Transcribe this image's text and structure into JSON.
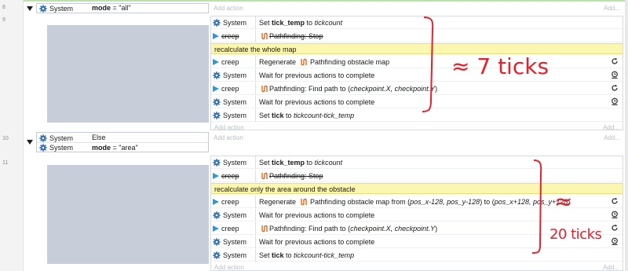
{
  "events": [
    {
      "line": "8",
      "conditions": [
        {
          "object": "System",
          "text_bold": "mode",
          "text_rest": " = \"all\""
        }
      ],
      "add_action": "Add action",
      "add_label": "Add..."
    },
    {
      "line": "9",
      "actions": [
        {
          "object": "System",
          "pre": "Set ",
          "bold": "tick_temp",
          "mid": " to ",
          "italic": "tickcount",
          "post": ""
        },
        {
          "object": "creep",
          "strike": true,
          "text": "Pathfinding: Stop"
        },
        {
          "comment": "recalculate the whole map"
        },
        {
          "object": "creep",
          "pre": "Regenerate ",
          "mid": " Pathfinding obstacle map",
          "right_icon": "refresh-icon"
        },
        {
          "object": "System",
          "text": "Wait for previous actions to complete",
          "right_icon": "clock-icon"
        },
        {
          "object": "creep",
          "pre": "Pathfinding: Find path to (",
          "italic": "checkpoint.X, checkpoint.Y",
          "post": ")",
          "right_icon": "refresh-icon"
        },
        {
          "object": "System",
          "text": "Wait for previous actions to complete",
          "right_icon": "clock-icon"
        },
        {
          "object": "System",
          "pre": "Set ",
          "bold": "tick",
          "mid": " to ",
          "italic": "tickcount-tick_temp",
          "post": ""
        }
      ],
      "add_action": "Add action",
      "add_label": "Add..."
    },
    {
      "line": "10",
      "conditions": [
        {
          "object": "System",
          "text_bold": "",
          "text_rest": "Else"
        },
        {
          "object": "System",
          "text_bold": "mode",
          "text_rest": " = \"area\""
        }
      ],
      "add_action": "Add action",
      "add_label": "Add..."
    },
    {
      "line": "11",
      "actions": [
        {
          "object": "System",
          "pre": "Set ",
          "bold": "tick_temp",
          "mid": " to ",
          "italic": "tickcount",
          "post": ""
        },
        {
          "object": "creep",
          "strike": true,
          "text": "Pathfinding: Stop"
        },
        {
          "comment": "recalculate only the area around the obstacle"
        },
        {
          "object": "creep",
          "pre": "Regenerate ",
          "mid": " Pathfinding obstacle map from (",
          "italic": "pos_x-128, pos_y-128",
          "mid2": ") to (",
          "italic2": "pos_x+128, pos_y+128",
          "post": ")",
          "right_icon": "refresh-icon"
        },
        {
          "object": "System",
          "text": "Wait for previous actions to complete",
          "right_icon": "clock-icon"
        },
        {
          "object": "creep",
          "pre": "Pathfinding: Find path to (",
          "italic": "checkpoint.X, checkpoint.Y",
          "post": ")",
          "right_icon": "refresh-icon"
        },
        {
          "object": "System",
          "text": "Wait for previous actions to complete",
          "right_icon": "clock-icon"
        },
        {
          "object": "System",
          "pre": "Set ",
          "bold": "tick",
          "mid": " to ",
          "italic": "tickcount-tick_temp",
          "post": ""
        }
      ],
      "add_action": "Add action",
      "add_label": "Add..."
    }
  ],
  "annotations": {
    "top": "≈ 7 ticks",
    "bottom_symbol": "≈",
    "bottom": "20 ticks"
  },
  "colors": {
    "comment_bg": "#fbf7b0",
    "gray_panel": "#c8ced9",
    "annotation": "#e8202a",
    "creep_icon": "#2d9ad6"
  }
}
